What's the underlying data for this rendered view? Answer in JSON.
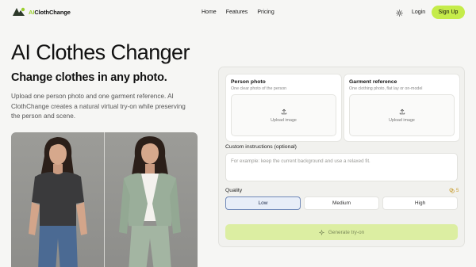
{
  "nav": {
    "logo_prefix": "AI",
    "logo_suffix": "ClothChange",
    "links": [
      "Home",
      "Features",
      "Pricing"
    ],
    "login_label": "Login",
    "signup_label": "Sign Up",
    "theme_icon": "sun-icon",
    "accent": "#c5ec4a"
  },
  "hero": {
    "title": "AI Clothes Changer",
    "subtitle": "Change clothes in any photo.",
    "description": "Upload one person photo and one garment reference. AI ClothChange creates a natural virtual try-on while preserving the person and scene."
  },
  "form": {
    "person": {
      "title": "Person photo",
      "subtitle": "One clear photo of the person",
      "upload_label": "Upload image"
    },
    "garment": {
      "title": "Garment reference",
      "subtitle": "One clothing photo, flat lay or on-model",
      "upload_label": "Upload image"
    },
    "custom_label": "Custom instructions (optional)",
    "custom_placeholder": "For example: keep the current background and use a relaxed fit.",
    "quality_label": "Quality",
    "quality_cost": "5",
    "quality_options": [
      "Low",
      "Medium",
      "High"
    ],
    "quality_selected": "Low",
    "generate_label": "Generate try-on"
  }
}
